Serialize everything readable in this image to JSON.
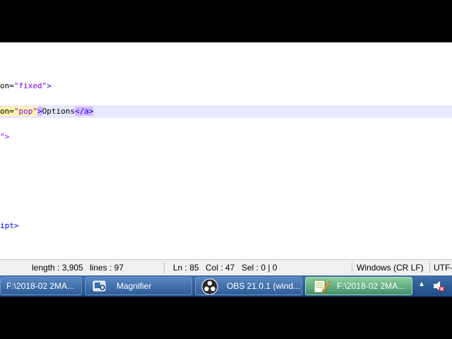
{
  "editor": {
    "lines": [
      {
        "attr": "on=",
        "value": "\"fixed\"",
        "tail": ">"
      },
      {
        "attr": "on=",
        "value": "\"pop\"",
        "open_end": ">",
        "text": "Options",
        "close_tag": "</a>"
      },
      {
        "text": "\">"
      },
      {
        "text": "ipt>"
      }
    ]
  },
  "status": {
    "length": "length : 3,905",
    "lines": "lines : 97",
    "ln": "Ln : 85",
    "col": "Col : 47",
    "sel": "Sel : 0 | 0",
    "eol": "Windows (CR LF)",
    "encoding": "UTF-"
  },
  "taskbar": {
    "items": [
      {
        "label": "F:\\2018-02 2MA...",
        "icon": "notepadpp-icon"
      },
      {
        "label": "Magnifier",
        "icon": "magnifier-icon"
      },
      {
        "label": "OBS 21.0.1 (wind...",
        "icon": "obs-icon"
      },
      {
        "label": "F:\\2018-02 2MA...",
        "icon": "notepadpp-icon",
        "active": true
      }
    ],
    "tray": {
      "arrow": "▲",
      "speaker_icon": "speaker-muted-icon"
    }
  },
  "colors": {
    "string": "#8000ff",
    "tag": "#0000ff",
    "current_line": "#e8e8ff",
    "attr_highlight": "#fff6a9",
    "tag_match": "#d9b8ff",
    "taskbar": "#2d5d99"
  }
}
